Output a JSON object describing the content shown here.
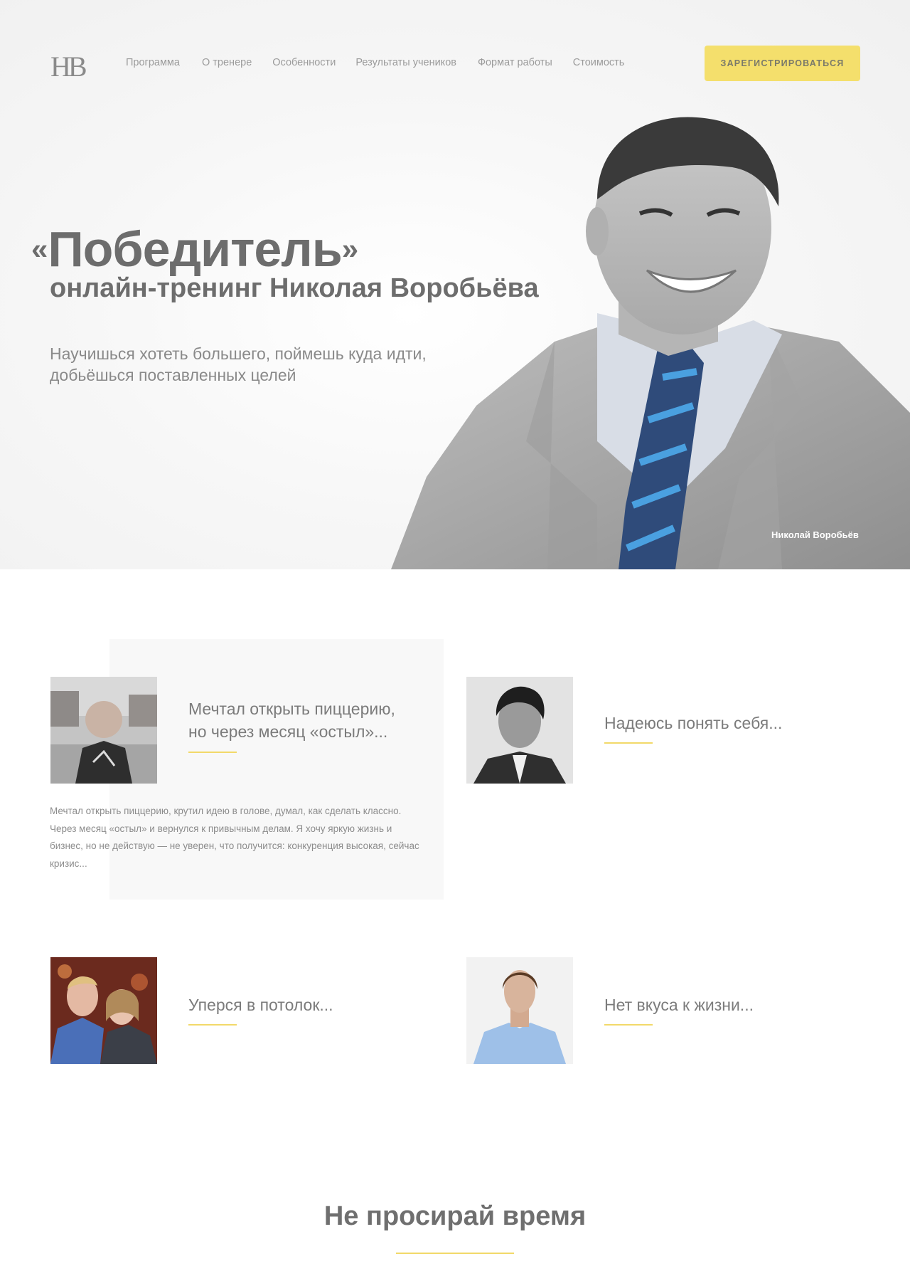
{
  "header": {
    "logo_text": "НВ",
    "nav": [
      {
        "label": "Программа"
      },
      {
        "label": "О тренере"
      },
      {
        "label": "Особенности"
      },
      {
        "label": "Результаты учеников"
      },
      {
        "label": "Формат работы"
      },
      {
        "label": "Стоимость"
      }
    ],
    "register_label": "Зарегистрироваться"
  },
  "hero": {
    "title_open_quote": "«",
    "title": "Победитель",
    "title_close_quote": "»",
    "subtitle": "онлайн-тренинг Николая Воробьёва",
    "lead_line1": "Научишься хотеть большего, поймешь куда идти,",
    "lead_line2": "добьёшься поставленных целей",
    "photo_caption": "Николай Воробьёв"
  },
  "testimonials": [
    {
      "title_line1": "Мечтал открыть пиццерию,",
      "title_line2": "но через месяц «остыл»...",
      "body": "Мечтал открыть пиццерию, крутил идею в голове, думал, как сделать классно. Через месяц «остыл» и вернулся к привычным делам. Я хочу яркую жизнь и бизнес, но не действую — не уверен, что получится: конкуренция высокая, сейчас кризис..."
    },
    {
      "title_line1": "Надеюсь понять себя..."
    },
    {
      "title_line1": "Уперся в потолок..."
    },
    {
      "title_line1": "Нет вкуса к жизни..."
    }
  ],
  "bottom": {
    "title": "Не просирай время"
  },
  "colors": {
    "accent": "#f4df6c",
    "text": "#6d6d6d"
  }
}
